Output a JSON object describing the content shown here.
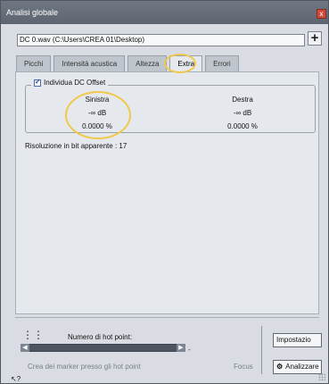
{
  "window": {
    "title": "Analisi globale",
    "close_symbol": "x"
  },
  "file": {
    "path": "DC 0.wav (C:\\Users\\CREA 01\\Desktop)",
    "add_symbol": "+"
  },
  "tabs": [
    {
      "label": "Picchi"
    },
    {
      "label": "Intensità acustica"
    },
    {
      "label": "Altezza"
    },
    {
      "label": "Extra"
    },
    {
      "label": "Errori"
    }
  ],
  "extra": {
    "checkbox_label": "Individua DC Offset",
    "columns": {
      "left": {
        "header": "Sinistra",
        "db": "-∞ dB",
        "percent": "0.0000 %"
      },
      "right": {
        "header": "Destra",
        "db": "-∞ dB",
        "percent": "0.0000 %"
      }
    },
    "bit_resolution": "Risoluzione in bit apparente : 17"
  },
  "bottom": {
    "hot_point_label": "Numero di hot point:",
    "slider_dash": "-",
    "marker_text": "Crea dei marker presso gli hot point",
    "focus_text": "Focus",
    "setup_label": "Impostazio",
    "analyze_label": "Analizzare"
  }
}
